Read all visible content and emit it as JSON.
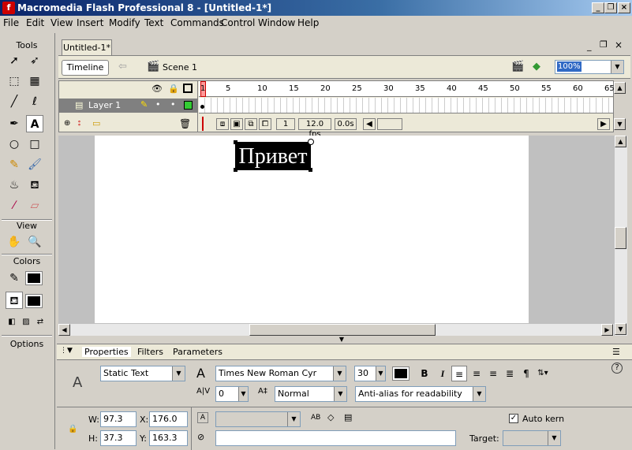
{
  "app": {
    "title": "Macromedia Flash Professional 8 - [Untitled-1*]"
  },
  "window_buttons": {
    "minimize": "_",
    "restore": "❐",
    "close": "×"
  },
  "menu": [
    "File",
    "Edit",
    "View",
    "Insert",
    "Modify",
    "Text",
    "Commands",
    "Control",
    "Window",
    "Help"
  ],
  "tools": {
    "title": "Tools",
    "view_label": "View",
    "colors_label": "Colors",
    "options_label": "Options"
  },
  "document": {
    "tab": "Untitled-1*",
    "timeline_button": "Timeline",
    "scene": "Scene 1",
    "zoom": "100%"
  },
  "timeline": {
    "layer": "Layer 1",
    "ruler": [
      "1",
      "5",
      "10",
      "15",
      "20",
      "25",
      "30",
      "35",
      "40",
      "45",
      "50",
      "55",
      "60",
      "65"
    ],
    "current_frame": "1",
    "fps": "12.0 fps",
    "time": "0.0s"
  },
  "stage": {
    "text": "Привет"
  },
  "properties": {
    "tabs": [
      "Properties",
      "Filters",
      "Parameters"
    ],
    "text_type": "Static Text",
    "font": "Times New Roman Cyr",
    "font_size": "30",
    "letter_spacing": "0",
    "position": "Normal",
    "antialias": "Anti-alias for readability",
    "w_label": "W:",
    "w": "97.3",
    "h_label": "H:",
    "h": "37.3",
    "x_label": "X:",
    "x": "176.0",
    "y_label": "Y:",
    "y": "163.3",
    "auto_kern": "Auto kern",
    "target_label": "Target:",
    "bold": "B",
    "italic": "I"
  },
  "colors": {
    "fill": "#000000",
    "title_bar": "#0a246a",
    "stage": "#ffffff",
    "text_bg": "#000000"
  }
}
